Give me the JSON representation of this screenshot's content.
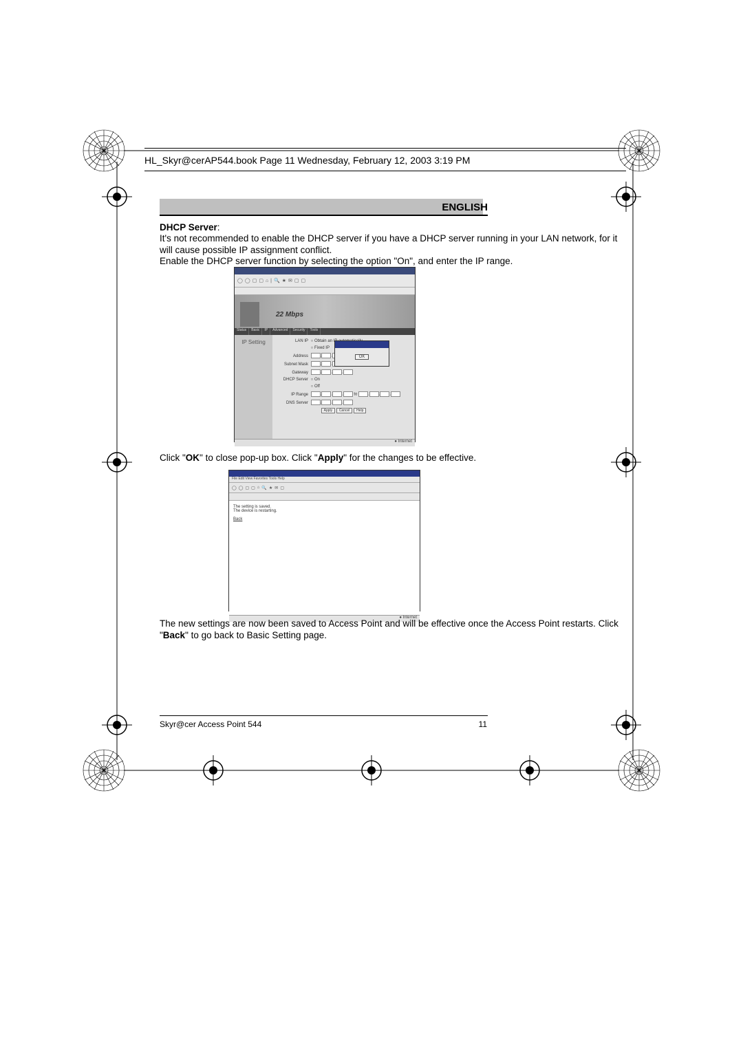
{
  "header": {
    "running_head": "HL_Skyr@cerAP544.book  Page 11  Wednesday, February 12, 2003  3:19 PM"
  },
  "page": {
    "language_label": "ENGLISH",
    "section_title": "DHCP Server",
    "para1": "It's not recommended to enable the DHCP server if you have a DHCP server running in your LAN network, for it will cause possible IP assignment conflict.",
    "para2": "Enable the DHCP server function by selecting the option \"On\", and enter the IP range.",
    "para3_pre": "Click \"",
    "para3_ok": "OK",
    "para3_mid": "\" to close pop-up box. Click \"",
    "para3_apply": "Apply",
    "para3_post": "\" for the changes to be effective.",
    "para4_pre": "The new settings are now been saved to Access Point and will be effective once the Access Point restarts. Click \"",
    "para4_back": "Back",
    "para4_post": "\" to go back to Basic Setting page."
  },
  "screenshot1": {
    "brand": "22 Mbps",
    "side_label": "IP Setting",
    "rows": {
      "lanip": "LAN IP",
      "obtain": "Obtain an IP automatically",
      "fixed": "Fixed IP",
      "address": "Address",
      "mask": "Subnet Mask",
      "gateway": "Gateway",
      "dhcp": "DHCP Server",
      "on": "On",
      "off": "Off",
      "range": "IP Range",
      "dns": "DNS Server",
      "apply": "Apply",
      "cancel": "Cancel",
      "help": "Help"
    },
    "popup_ok": "OK",
    "status": "Internet"
  },
  "screenshot2": {
    "msg1": "The setting is saved.",
    "msg2": "The device is restarting.",
    "back": "Back",
    "status": "Internet"
  },
  "footer": {
    "product": "Skyr@cer Access Point 544",
    "page_number": "11"
  }
}
